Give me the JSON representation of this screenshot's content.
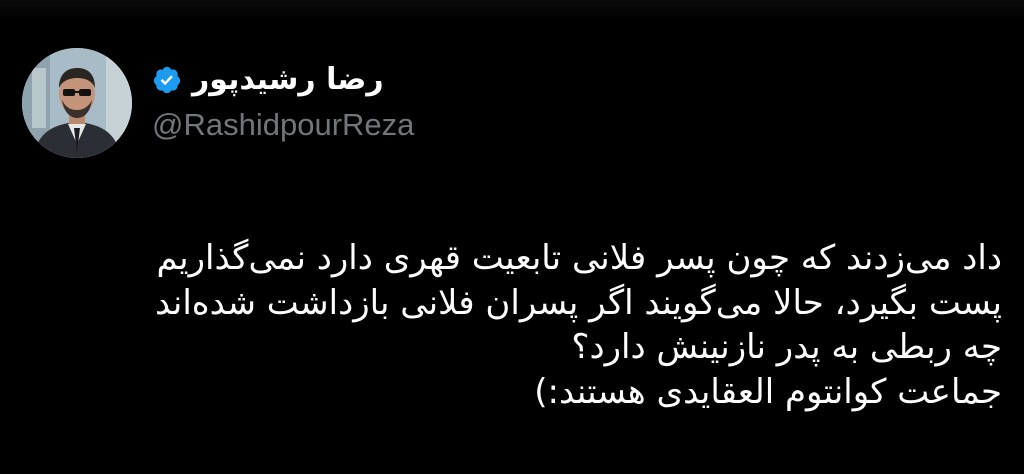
{
  "tweet": {
    "author": {
      "display_name": "رضا رشیدپور",
      "handle": "@RashidpourReza",
      "verified": true,
      "verified_badge_color": "#1d9bf0",
      "avatar_icon": "profile-photo"
    },
    "text_lines": [
      "داد می‌زدند که چون پسر فلانی تابعیت قهری دارد نمی‌گذاریم",
      "پست بگیرد، حالا می‌گویند اگر پسران فلانی بازداشت شده‌اند",
      "چه ربطی به پدر نازنینش دارد؟",
      "جماعت کوانتوم العقایدی هستند:)"
    ]
  },
  "colors": {
    "background": "#000000",
    "text_primary": "#ffffff",
    "text_secondary": "#71767b",
    "accent": "#1d9bf0"
  }
}
